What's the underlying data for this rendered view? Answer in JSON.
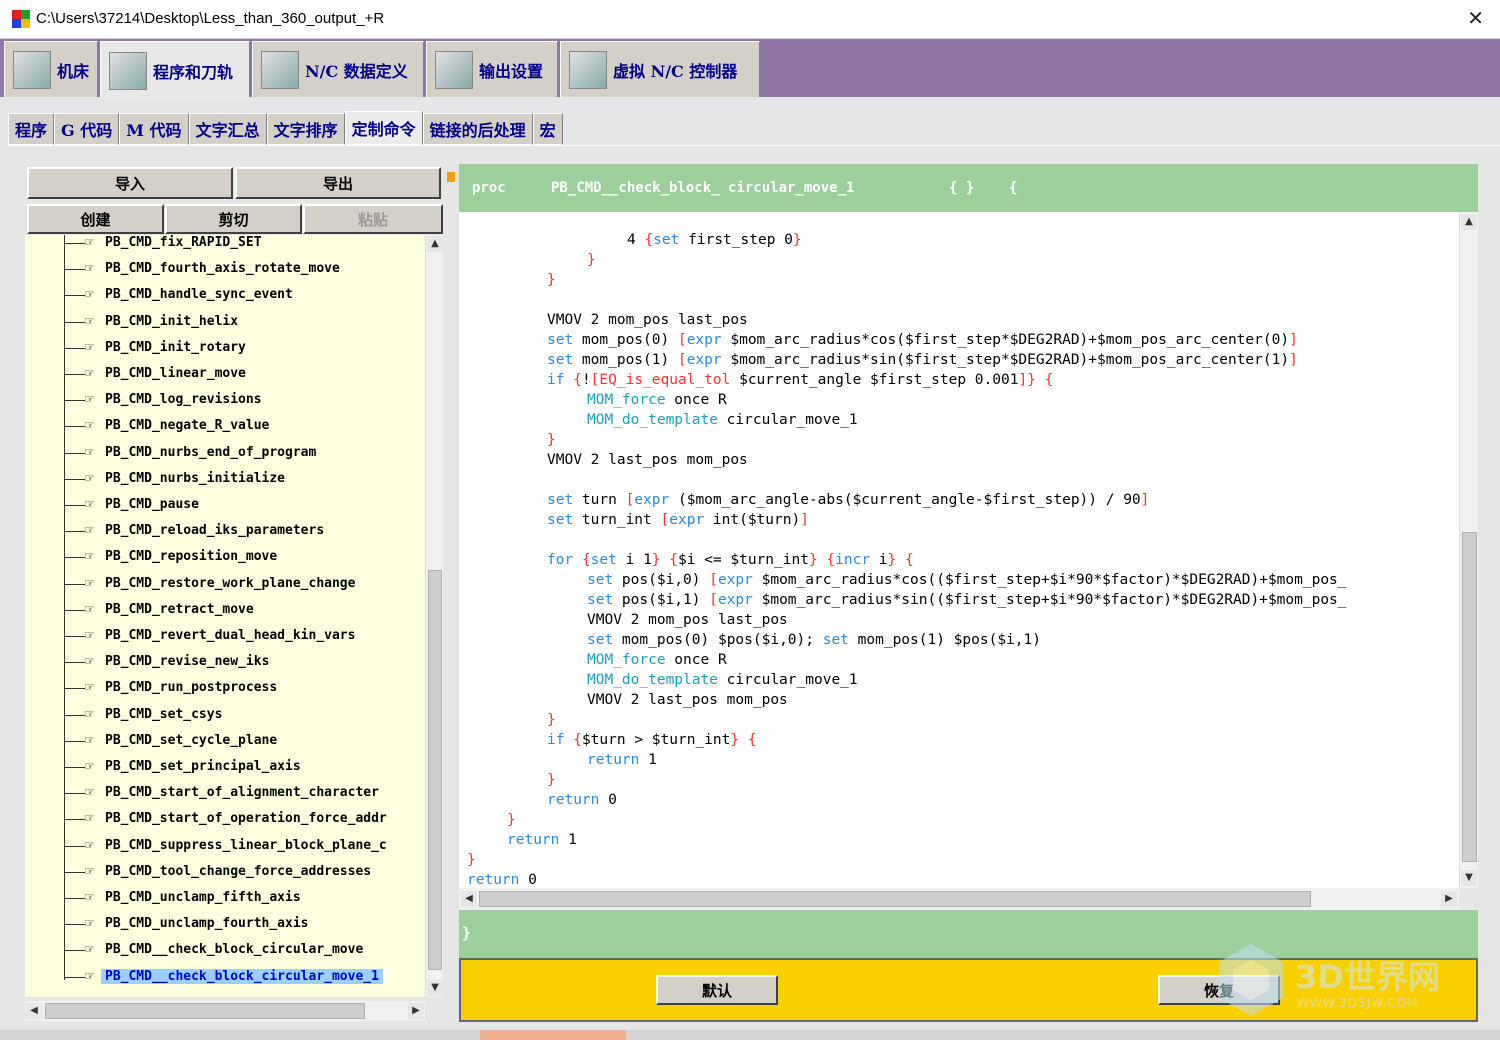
{
  "window": {
    "title": "C:\\Users\\37214\\Desktop\\Less_than_360_output_+R",
    "close_icon": "close-icon"
  },
  "main_tabs": [
    {
      "label": "机床",
      "icon": "machine-tool-icon"
    },
    {
      "label": "程序和刀轨",
      "icon": "program-toolpath-icon"
    },
    {
      "label": "N/C 数据定义",
      "icon": "nc-data-definition-icon"
    },
    {
      "label": "输出设置",
      "icon": "printer-icon"
    },
    {
      "label": "虚拟 N/C 控制器",
      "icon": "virtual-nc-controller-icon"
    }
  ],
  "sub_tabs": [
    "程序",
    "G 代码",
    "M 代码",
    "文字汇总",
    "文字排序",
    "定制命令",
    "链接的后处理",
    "宏"
  ],
  "buttons": {
    "import": "导入",
    "export": "导出",
    "create": "创建",
    "cut": "剪切",
    "paste": "粘贴",
    "default": "默认",
    "restore": "恢复"
  },
  "tree_items": [
    "PB_CMD_fix_RAPID_SET",
    "PB_CMD_fourth_axis_rotate_move",
    "PB_CMD_handle_sync_event",
    "PB_CMD_init_helix",
    "PB_CMD_init_rotary",
    "PB_CMD_linear_move",
    "PB_CMD_log_revisions",
    "PB_CMD_negate_R_value",
    "PB_CMD_nurbs_end_of_program",
    "PB_CMD_nurbs_initialize",
    "PB_CMD_pause",
    "PB_CMD_reload_iks_parameters",
    "PB_CMD_reposition_move",
    "PB_CMD_restore_work_plane_change",
    "PB_CMD_retract_move",
    "PB_CMD_revert_dual_head_kin_vars",
    "PB_CMD_revise_new_iks",
    "PB_CMD_run_postprocess",
    "PB_CMD_set_csys",
    "PB_CMD_set_cycle_plane",
    "PB_CMD_set_principal_axis",
    "PB_CMD_start_of_alignment_character",
    "PB_CMD_start_of_operation_force_addr",
    "PB_CMD_suppress_linear_block_plane_c",
    "PB_CMD_tool_change_force_addresses",
    "PB_CMD_unclamp_fifth_axis",
    "PB_CMD_unclamp_fourth_axis",
    "PB_CMD__check_block_circular_move",
    "PB_CMD__check_block_circular_move_1"
  ],
  "proc_header": {
    "proc": "proc",
    "name": "PB_CMD__check_block_ circular_move_1",
    "args": "{ }",
    "brace": "{"
  },
  "footer_brace": "}",
  "code_lines": [
    "4 {set first_step 0}",
    "}",
    "}",
    "",
    "VMOV 2 mom_pos last_pos",
    "set mom_pos(0) [expr $mom_arc_radius*cos($first_step*$DEG2RAD)+$mom_pos_arc_center(0)]",
    "set mom_pos(1) [expr $mom_arc_radius*sin($first_step*$DEG2RAD)+$mom_pos_arc_center(1)]",
    "if {![EQ_is_equal_tol $current_angle $first_step 0.001]} {",
    "MOM_force once R",
    "MOM_do_template circular_move_1",
    "}",
    "VMOV 2 last_pos mom_pos",
    "",
    "set turn [expr ($mom_arc_angle-abs($current_angle-$first_step)) / 90]",
    "set turn_int [expr int($turn)]",
    "",
    "for {set i 1} {$i <= $turn_int} {incr i} {",
    "set pos($i,0) [expr $mom_arc_radius*cos(($first_step+$i*90*$factor)*$DEG2RAD)+$mom_pos_",
    "set pos($i,1) [expr $mom_arc_radius*sin(($first_step+$i*90*$factor)*$DEG2RAD)+$mom_pos_",
    "VMOV 2 mom_pos last_pos",
    "set mom_pos(0) $pos($i,0); set mom_pos(1) $pos($i,1)",
    "MOM_force once R",
    "MOM_do_template circular_move_1",
    "VMOV 2 last_pos mom_pos",
    "}",
    "if {$turn > $turn_int} {",
    "return 1",
    "}",
    "return 0",
    "}",
    "return 1",
    "}",
    "return 0"
  ],
  "watermark": {
    "text": "3D世界网",
    "sub": "WWW.3DSJW.COM"
  },
  "colors": {
    "tab_bar": "#9076a6",
    "proc_header": "#9dcf9d",
    "button_bar": "#f8d000",
    "tree_bg": "#ffffe0",
    "selected": "#9ad0ff"
  }
}
